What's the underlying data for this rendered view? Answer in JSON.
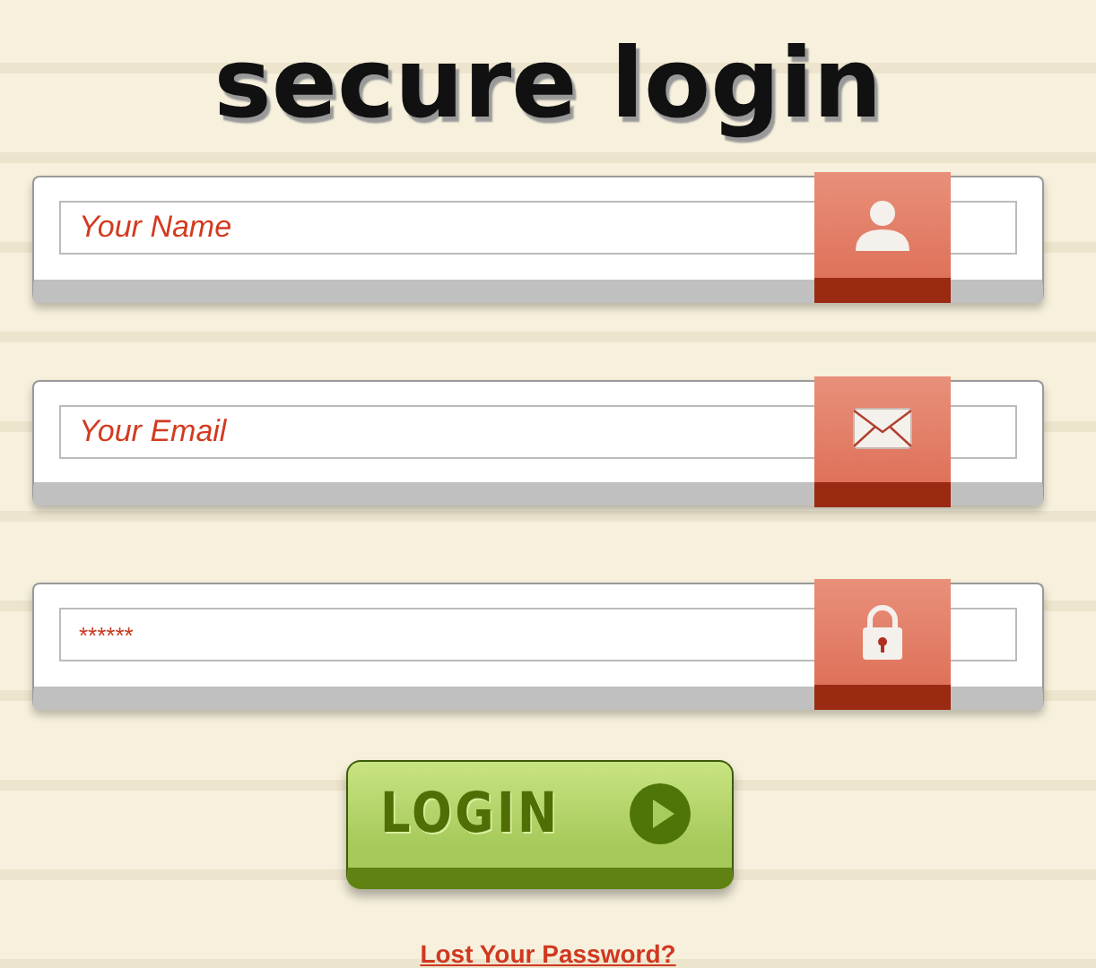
{
  "title": "secure login",
  "fields": [
    {
      "kind": "name",
      "placeholder": "Your Name"
    },
    {
      "kind": "email",
      "placeholder": "Your Email"
    },
    {
      "kind": "password",
      "placeholder": "******"
    }
  ],
  "login_button": {
    "label": "LOGIN"
  },
  "lost_password_link": "Lost Your Password?"
}
